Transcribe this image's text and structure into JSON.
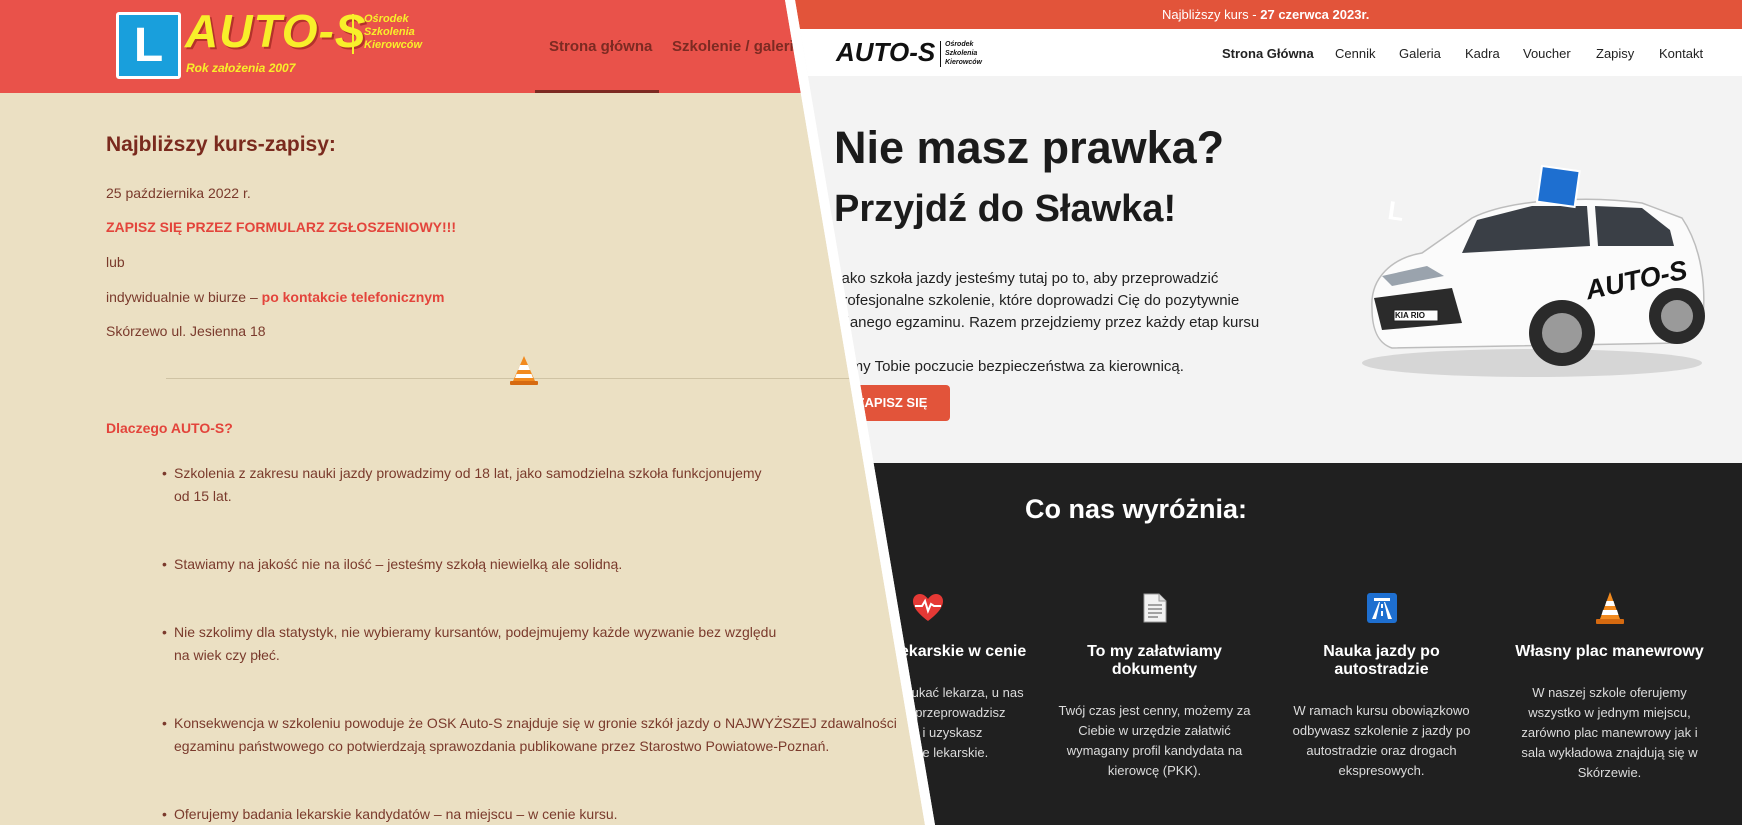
{
  "old_site": {
    "logo": {
      "letter": "L",
      "name": "AUTO-S",
      "subtitle": "Ośrodek Szkolenia Kierowców",
      "founded": "Rok założenia 2007"
    },
    "nav": [
      {
        "label": "Strona główna",
        "active": true
      },
      {
        "label": "Szkolenie / galeria",
        "active": false
      }
    ],
    "heading": "Najbliższy kurs-zapisy:",
    "course_date": "25 października 2022 r.",
    "signup_cta": "ZAPISZ SIĘ PRZEZ FORMULARZ ZGŁOSZENIOWY!!!",
    "or_text": "lub",
    "office_text": "indywidualnie w biurze –",
    "office_link": "po kontakcie telefonicznym",
    "address": "Skórzewo ul. Jesienna 18",
    "why_heading": "Dlaczego AUTO-S?",
    "bullets": [
      {
        "line1": "Szkolenia z zakresu nauki jazdy prowadzimy od 18 lat, jako samodzielna szkoła funkcjonujemy",
        "line2": "od 15 lat."
      },
      {
        "line1": "Stawiamy na jakość nie na ilość – jesteśmy szkołą niewielką ale solidną.",
        "line2": ""
      },
      {
        "line1": "Nie szkolimy dla statystyk, nie wybieramy kursantów, podejmujemy każde wyzwanie bez względu",
        "line2": "na wiek czy płeć."
      },
      {
        "line1": "Konsekwencja w szkoleniu powoduje że OSK Auto-S znajduje się w gronie szkół jazdy o NAJWYŻSZEJ zdawalności",
        "line2": "egzaminu państwowego co potwierdzają sprawozdania publikowane przez Starostwo Powiatowe-Poznań."
      },
      {
        "line1": "Oferujemy badania lekarskie kandydatów – na miejscu – w cenie kursu.",
        "line2": ""
      }
    ],
    "colors": {
      "header": "#e9524a",
      "background": "#ebe0c3",
      "accent": "#e3443b",
      "logo_yellow": "#f8ef2a",
      "logo_blue": "#199fdc"
    }
  },
  "new_site": {
    "topbar": {
      "prefix": "Najbliższy kurs - ",
      "date": "27 czerwca 2023r."
    },
    "logo": {
      "name": "AUTO-S",
      "subtitle": "Ośrodek Szkolenia Kierowców"
    },
    "nav": [
      {
        "label": "Strona Główna",
        "active": true
      },
      {
        "label": "Cennik",
        "active": false
      },
      {
        "label": "Galeria",
        "active": false
      },
      {
        "label": "Kadra",
        "active": false
      },
      {
        "label": "Voucher",
        "active": false
      },
      {
        "label": "Zapisy",
        "active": false
      },
      {
        "label": "Kontakt",
        "active": false
      }
    ],
    "hero": {
      "title": "Nie masz prawka?",
      "subtitle": "Przyjdź do Sławka!",
      "lead_lines": [
        "Jako szkoła jazdy jesteśmy tutaj po to, aby przeprowadzić",
        "profesjonalne szkolenie, które doprowadzi Cię do pozytywnie",
        "zdanego egzaminu. Razem przejdziemy przez każdy etap kursu i",
        "damy Tobie poczucie bezpieczeństwa za kierownicą."
      ],
      "cta": "ZAPISZ SIĘ",
      "car_sign": "L",
      "car_brand": "AUTO-S",
      "car_plate": "KIA RIO"
    },
    "features_heading": "Co nas wyróżnia:",
    "features": [
      {
        "icon": "heart-pulse-icon",
        "title": "Badania lekarskie w cenie",
        "desc": [
          "Nie musisz szukać lekarza, u nas",
          "na miejscu przeprowadzisz",
          "badania i uzyskasz",
          "orzeczenie lekarskie."
        ]
      },
      {
        "icon": "document-icon",
        "title": "To my załatwiamy dokumenty",
        "desc": [
          "Twój czas jest cenny, możemy za",
          "Ciebie w urzędzie załatwić",
          "wymagany profil kandydata na",
          "kierowcę (PKK)."
        ]
      },
      {
        "icon": "highway-icon",
        "title": "Nauka jazdy po autostradzie",
        "desc": [
          "W ramach kursu obowiązkowo",
          "odbywasz szkolenie z jazdy po",
          "autostradzie oraz drogach",
          "ekspresowych."
        ]
      },
      {
        "icon": "traffic-cone-icon",
        "title": "Własny plac manewrowy",
        "desc": [
          "W naszej szkole oferujemy",
          "wszystko w jednym miejscu,",
          "zarówno plac manewrowy jak i",
          "sala wykładowa znajdują się w",
          "Skórzewie."
        ]
      }
    ],
    "colors": {
      "accent": "#e2543a",
      "dark": "#202020",
      "hero_bg": "#f3f3f3"
    }
  }
}
